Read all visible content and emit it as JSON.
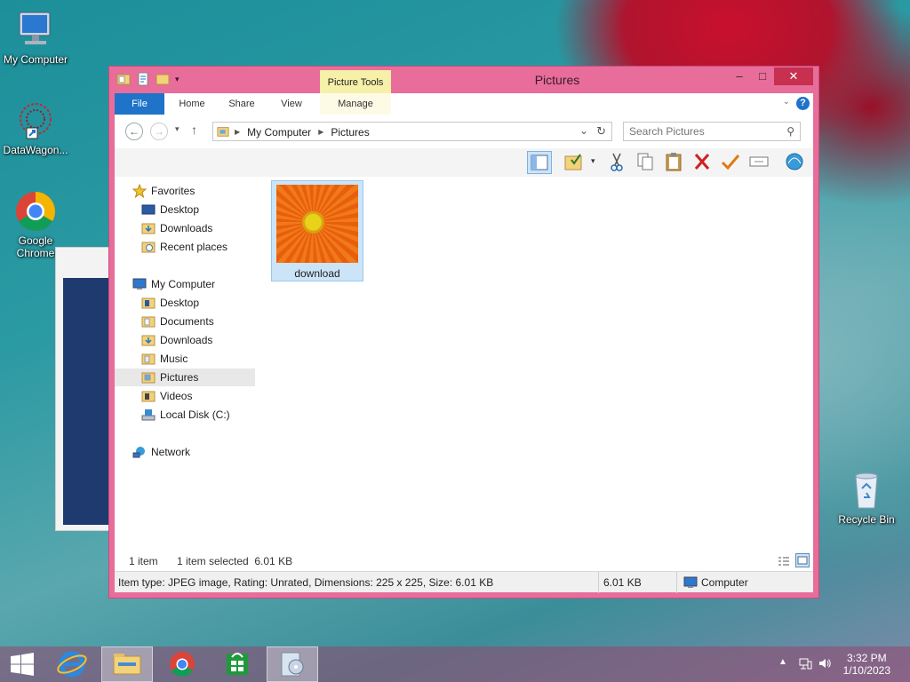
{
  "desktop": {
    "icons": [
      {
        "label": "My Computer"
      },
      {
        "label": "DataWagon..."
      },
      {
        "label": "Google Chrome"
      },
      {
        "label": "Recycle Bin"
      }
    ]
  },
  "window": {
    "title": "Pictures",
    "contextual_tab_group": "Picture Tools",
    "controls": {
      "minimize": "–",
      "maximize": "□",
      "close": "✕"
    }
  },
  "ribbon": {
    "tabs": [
      {
        "label": "File"
      },
      {
        "label": "Home"
      },
      {
        "label": "Share"
      },
      {
        "label": "View"
      },
      {
        "label": "Manage"
      }
    ],
    "help": "?"
  },
  "address": {
    "breadcrumbs": [
      "My Computer",
      "Pictures"
    ],
    "search_placeholder": "Search Pictures"
  },
  "navpane": {
    "favorites_header": "Favorites",
    "favorites": [
      {
        "label": "Desktop"
      },
      {
        "label": "Downloads"
      },
      {
        "label": "Recent places"
      }
    ],
    "computer_header": "My Computer",
    "computer": [
      {
        "label": "Desktop"
      },
      {
        "label": "Documents"
      },
      {
        "label": "Downloads"
      },
      {
        "label": "Music"
      },
      {
        "label": "Pictures"
      },
      {
        "label": "Videos"
      },
      {
        "label": "Local Disk (C:)"
      }
    ],
    "network": "Network"
  },
  "files": [
    {
      "name": "download",
      "selected": true
    }
  ],
  "status": {
    "count": "1 item",
    "selection": "1 item selected  6.01 KB"
  },
  "details": {
    "info": "Item type: JPEG image, Rating: Unrated, Dimensions: 225 x 225, Size: 6.01 KB",
    "size": "6.01 KB",
    "location": "Computer"
  },
  "taskbar": {
    "time": "3:32 PM",
    "date": "1/10/2023"
  },
  "colors": {
    "window_frame": "#e86d9a",
    "accent_blue": "#1f73c9",
    "close_button": "#c7304f",
    "selection": "#cce4f7"
  }
}
